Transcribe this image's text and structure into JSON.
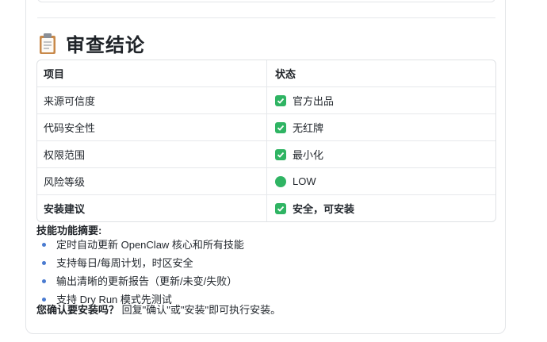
{
  "heading": {
    "icon": "clipboard-icon",
    "title": "审查结论"
  },
  "table": {
    "headers": [
      "项目",
      "状态"
    ],
    "rows": [
      {
        "item": "来源可信度",
        "status_icon": "check-icon",
        "status": "官方出品"
      },
      {
        "item": "代码安全性",
        "status_icon": "check-icon",
        "status": "无红牌"
      },
      {
        "item": "权限范围",
        "status_icon": "check-icon",
        "status": "最小化"
      },
      {
        "item": "风险等级",
        "status_icon": "green-circle-icon",
        "status": "LOW"
      },
      {
        "item": "安装建议",
        "status_icon": "check-icon",
        "status": "安全，可安装"
      }
    ]
  },
  "summary": {
    "title": "技能功能摘要:",
    "items": [
      "定时自动更新 OpenClaw 核心和所有技能",
      "支持每日/每周计划，时区安全",
      "输出清晰的更新报告（更新/未变/失败）",
      "支持 Dry Run 模式先测试"
    ]
  },
  "confirm": {
    "question": "您确认要安装吗？",
    "instruction": " 回复\"确认\"或\"安装\"即可执行安装。"
  },
  "colors": {
    "check_green": "#2fb463",
    "bullet_blue": "#4a7bd0"
  }
}
